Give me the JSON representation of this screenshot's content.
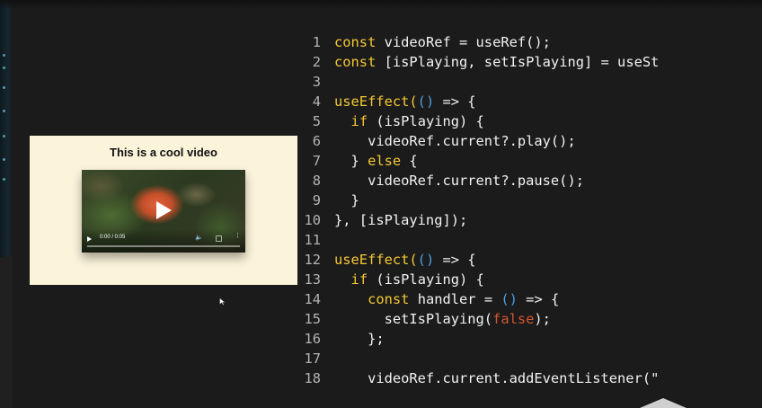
{
  "preview": {
    "title": "This is a cool video",
    "video": {
      "time_display": "0:00 / 0:05",
      "progress_fraction": 0.0
    }
  },
  "code": {
    "colors": {
      "keyword": "#f5c832",
      "paren": "#4c9ee0",
      "boolean": "#d2552f",
      "text": "#f2f2f2",
      "line_number": "#b3b3b3"
    },
    "lines": [
      {
        "n": "1",
        "tokens": [
          {
            "t": "kw",
            "v": "const"
          },
          {
            "t": "text",
            "v": " videoRef = useRef();"
          }
        ]
      },
      {
        "n": "2",
        "tokens": [
          {
            "t": "kw",
            "v": "const"
          },
          {
            "t": "text",
            "v": " [isPlaying, setIsPlaying] = useSt"
          }
        ]
      },
      {
        "n": "3",
        "tokens": []
      },
      {
        "n": "4",
        "tokens": [
          {
            "t": "kw",
            "v": "useEffect("
          },
          {
            "t": "paren",
            "v": "()"
          },
          {
            "t": "text",
            "v": " => {"
          }
        ]
      },
      {
        "n": "5",
        "tokens": [
          {
            "t": "text",
            "v": "  "
          },
          {
            "t": "kw",
            "v": "if"
          },
          {
            "t": "text",
            "v": " (isPlaying) {"
          }
        ]
      },
      {
        "n": "6",
        "tokens": [
          {
            "t": "text",
            "v": "    videoRef.current?.play();"
          }
        ]
      },
      {
        "n": "7",
        "tokens": [
          {
            "t": "text",
            "v": "  } "
          },
          {
            "t": "kw",
            "v": "else"
          },
          {
            "t": "text",
            "v": " {"
          }
        ]
      },
      {
        "n": "8",
        "tokens": [
          {
            "t": "text",
            "v": "    videoRef.current?.pause();"
          }
        ]
      },
      {
        "n": "9",
        "tokens": [
          {
            "t": "text",
            "v": "  }"
          }
        ]
      },
      {
        "n": "10",
        "tokens": [
          {
            "t": "text",
            "v": "}, [isPlaying]);"
          }
        ]
      },
      {
        "n": "11",
        "tokens": []
      },
      {
        "n": "12",
        "tokens": [
          {
            "t": "kw",
            "v": "useEffect("
          },
          {
            "t": "paren",
            "v": "()"
          },
          {
            "t": "text",
            "v": " => {"
          }
        ]
      },
      {
        "n": "13",
        "tokens": [
          {
            "t": "text",
            "v": "  "
          },
          {
            "t": "kw",
            "v": "if"
          },
          {
            "t": "text",
            "v": " (isPlaying) {"
          }
        ]
      },
      {
        "n": "14",
        "tokens": [
          {
            "t": "text",
            "v": "    "
          },
          {
            "t": "kw",
            "v": "const"
          },
          {
            "t": "text",
            "v": " handler = "
          },
          {
            "t": "paren",
            "v": "()"
          },
          {
            "t": "text",
            "v": " => {"
          }
        ]
      },
      {
        "n": "15",
        "tokens": [
          {
            "t": "text",
            "v": "      setIsPlaying("
          },
          {
            "t": "bool",
            "v": "false"
          },
          {
            "t": "text",
            "v": ");"
          }
        ]
      },
      {
        "n": "16",
        "tokens": [
          {
            "t": "text",
            "v": "    };"
          }
        ]
      },
      {
        "n": "17",
        "tokens": []
      },
      {
        "n": "18",
        "tokens": [
          {
            "t": "text",
            "v": "    videoRef.current.addEventListener(\""
          }
        ]
      }
    ]
  }
}
